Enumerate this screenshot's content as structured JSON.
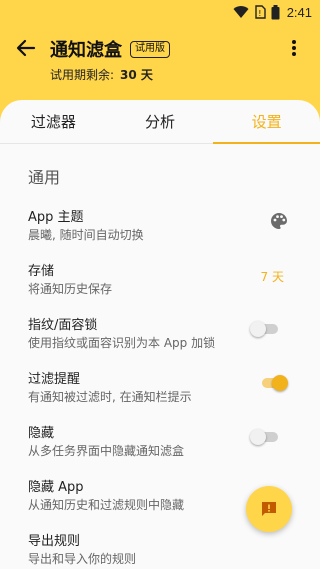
{
  "status_bar": {
    "time": "2:41"
  },
  "app_bar": {
    "title": "通知滤盒",
    "badge": "试用版",
    "trial_label": "试用期剩余:",
    "trial_days": "30 天"
  },
  "tabs": [
    {
      "label": "过滤器"
    },
    {
      "label": "分析"
    },
    {
      "label": "设置"
    }
  ],
  "section": {
    "title": "通用"
  },
  "settings": [
    {
      "title": "App 主题",
      "subtitle": "晨曦, 随时间自动切换"
    },
    {
      "title": "存储",
      "subtitle": "将通知历史保存",
      "value": "7 天"
    },
    {
      "title": "指纹/面容锁",
      "subtitle": "使用指纹或面容识别为本 App 加锁",
      "enabled": false
    },
    {
      "title": "过滤提醒",
      "subtitle": "有通知被过滤时, 在通知栏提示",
      "enabled": true
    },
    {
      "title": "隐藏",
      "subtitle": "从多任务界面中隐藏通知滤盒",
      "enabled": false
    },
    {
      "title": "隐藏 App",
      "subtitle": "从通知历史和过滤规则中隐藏"
    },
    {
      "title": "导出规则",
      "subtitle": "导出和导入你的规则"
    }
  ],
  "colors": {
    "accent": "#f2b21b",
    "app_bar": "#ffd54a"
  },
  "icons": {
    "theme": "palette-icon",
    "fab": "feedback-icon"
  }
}
